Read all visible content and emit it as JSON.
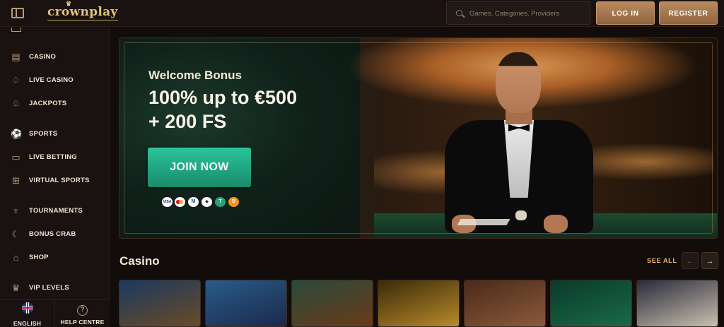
{
  "header": {
    "logo_text": "crownplay",
    "search_placeholder": "Games, Categories, Providers",
    "login_label": "LOG IN",
    "register_label": "REGISTER"
  },
  "sidebar": {
    "items": [
      {
        "label": "CASINO",
        "icon": "slot-machine-icon"
      },
      {
        "label": "LIVE CASINO",
        "icon": "spade-icon"
      },
      {
        "label": "JACKPOTS",
        "icon": "clover-icon"
      },
      {
        "label": "SPORTS",
        "icon": "soccer-ball-icon"
      },
      {
        "label": "LIVE BETTING",
        "icon": "tv-icon"
      },
      {
        "label": "VIRTUAL SPORTS",
        "icon": "gamepad-icon"
      },
      {
        "label": "TOURNAMENTS",
        "icon": "trophy-icon"
      },
      {
        "label": "BONUS CRAB",
        "icon": "crab-icon"
      },
      {
        "label": "SHOP",
        "icon": "shop-icon"
      },
      {
        "label": "VIP LEVELS",
        "icon": "crown-icon"
      }
    ],
    "language_label": "ENGLISH",
    "help_label": "HELP CENTRE"
  },
  "banner": {
    "subtitle": "Welcome Bonus",
    "headline_line1": "100% up to €500",
    "headline_line2": "+ 200 FS",
    "cta_label": "JOIN NOW",
    "payments": [
      "VISA",
      "mastercard",
      "M",
      "ETH",
      "T",
      "B"
    ]
  },
  "casino_section": {
    "title": "Casino",
    "see_all_label": "SEE ALL",
    "tiles": [
      {
        "name": "viking-game-tile",
        "colors": [
          "#1a3a5e",
          "#6a4a28"
        ]
      },
      {
        "name": "magician-game-tile",
        "colors": [
          "#2a5a8a",
          "#1a2a4a"
        ]
      },
      {
        "name": "pirate-game-tile",
        "colors": [
          "#2a4a3a",
          "#6a3a1a"
        ]
      },
      {
        "name": "gold-gem-game-tile",
        "colors": [
          "#3a2a0a",
          "#b88a2a"
        ]
      },
      {
        "name": "couple-game-tile",
        "colors": [
          "#4a2a1a",
          "#8a5a3a"
        ]
      },
      {
        "name": "fruit-game-tile",
        "colors": [
          "#0a3a2a",
          "#1a6a4a"
        ]
      },
      {
        "name": "cards-game-tile",
        "colors": [
          "#2a2a3a",
          "#c8c0b0"
        ]
      }
    ]
  },
  "colors": {
    "accent_gold": "#e2b474",
    "cta_green": "#2bc59b",
    "bg_dark": "#120c0a"
  }
}
